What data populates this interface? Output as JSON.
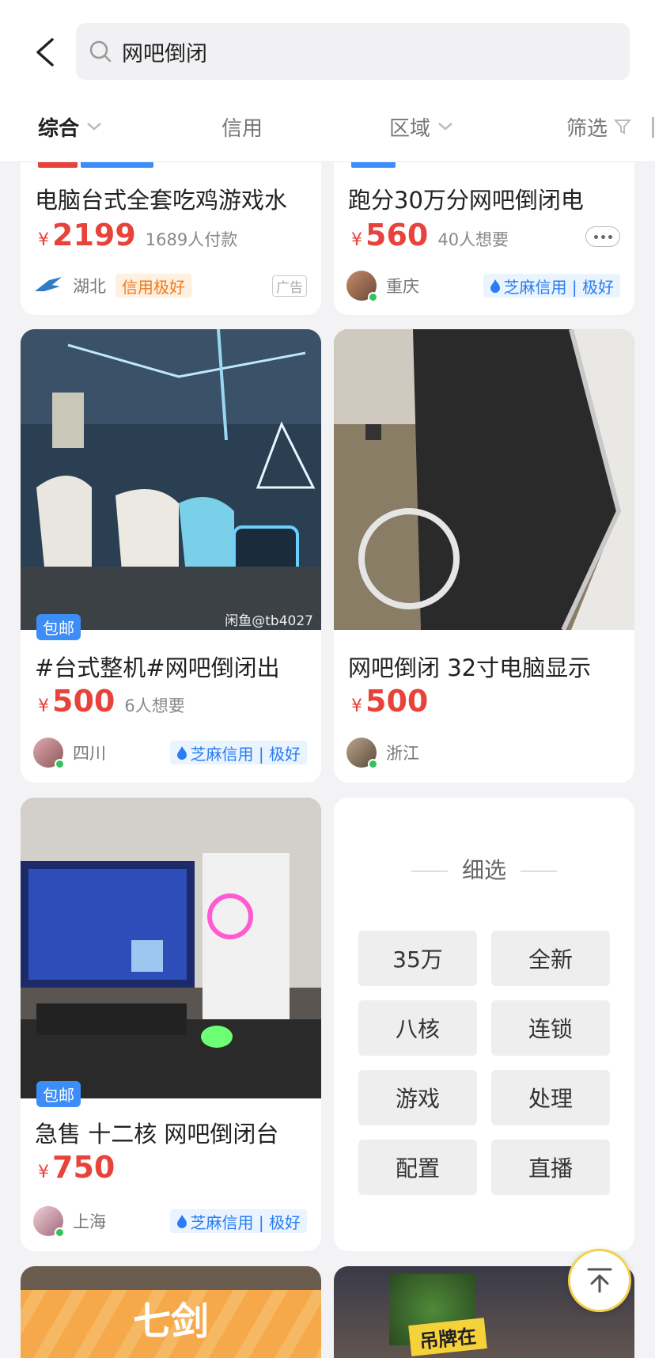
{
  "search": {
    "query": "网吧倒闭"
  },
  "tabs": [
    {
      "label": "综合"
    },
    {
      "label": "信用"
    },
    {
      "label": "区域"
    },
    {
      "label": "筛选"
    }
  ],
  "cards": [
    {
      "title": "电脑台式全套吃鸡游戏水",
      "currency": "¥",
      "price": "2199",
      "meta": "1689人付款",
      "region": "湖北",
      "credit": "信用极好",
      "ad": "广告"
    },
    {
      "title": "跑分30万分网吧倒闭电",
      "currency": "¥",
      "price": "560",
      "meta": "40人想要",
      "region": "重庆",
      "credit": "芝麻信用 | 极好"
    },
    {
      "title": "#台式整机#网吧倒闭出",
      "currency": "¥",
      "price": "500",
      "meta": "6人想要",
      "region": "四川",
      "credit": "芝麻信用 | 极好",
      "tag": "包邮",
      "watermark": "闲鱼@tb4027"
    },
    {
      "title": "网吧倒闭 32寸电脑显示",
      "currency": "¥",
      "price": "500",
      "meta": "",
      "region": "浙江",
      "credit": ""
    },
    {
      "title": "急售 十二核 网吧倒闭台",
      "currency": "¥",
      "price": "750",
      "meta": "",
      "region": "上海",
      "credit": "芝麻信用 | 极好",
      "tag": "包邮"
    },
    {
      "banner_text": "七剑"
    },
    {
      "banner_text": "吊牌在"
    }
  ],
  "filter": {
    "title": "细选",
    "chips": [
      "35万",
      "全新",
      "八核",
      "连锁",
      "游戏",
      "处理",
      "配置",
      "直播"
    ]
  },
  "colors": {
    "price": "#e8433b",
    "credit_blue": "#2a7df2",
    "credit_orange": "#f27a1a",
    "tag_blue": "#3c8df7"
  }
}
